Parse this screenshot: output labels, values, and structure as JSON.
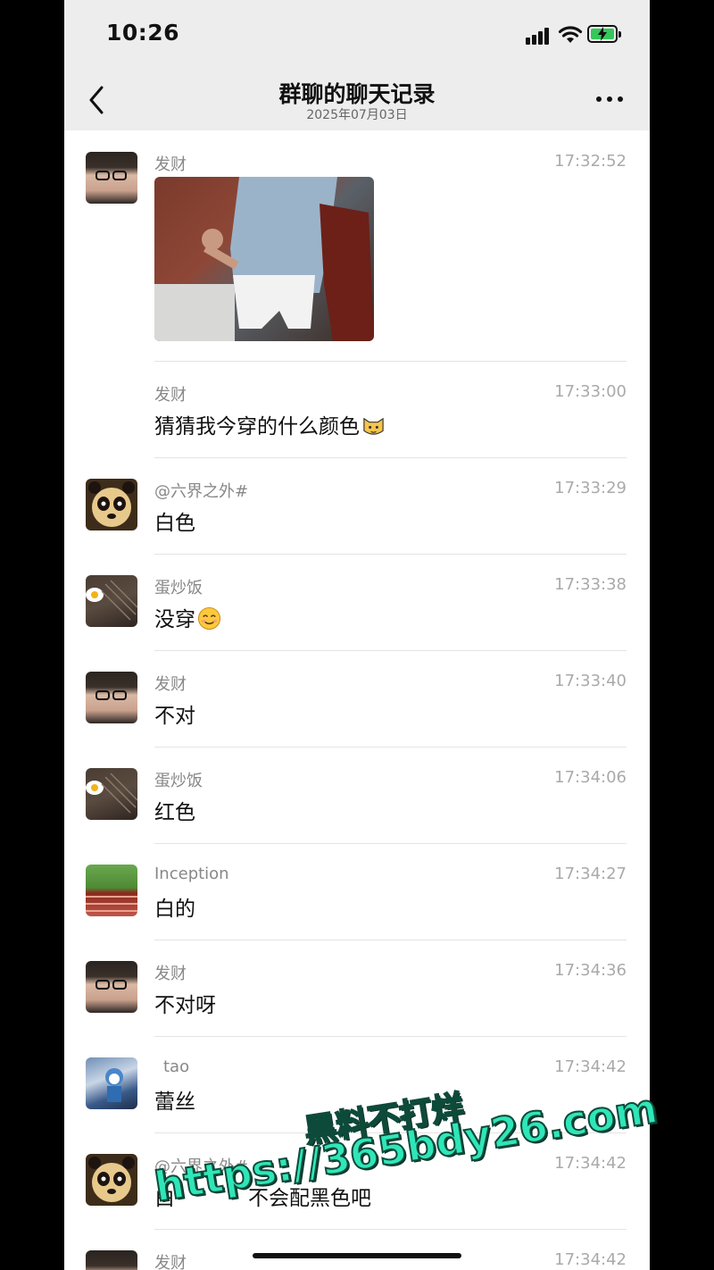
{
  "status_bar": {
    "time": "10:26"
  },
  "header": {
    "title": "群聊的聊天记录",
    "subtitle": "2025年07月03日"
  },
  "messages": [
    {
      "sender": "发财",
      "time": "17:32:52",
      "type": "image"
    },
    {
      "sender": "发财",
      "time": "17:33:00",
      "text": "猜猜我今穿的什么颜色",
      "emoji": "cat-emoji"
    },
    {
      "sender": "@六界之外#",
      "time": "17:33:29",
      "text": "白色"
    },
    {
      "sender": "蛋炒饭",
      "time": "17:33:38",
      "text": "没穿",
      "emoji": "smile-emoji"
    },
    {
      "sender": "发财",
      "time": "17:33:40",
      "text": "不对"
    },
    {
      "sender": "蛋炒饭",
      "time": "17:34:06",
      "text": "红色"
    },
    {
      "sender": "Inception",
      "time": "17:34:27",
      "text": "白的"
    },
    {
      "sender": "发财",
      "time": "17:34:36",
      "text": "不对呀"
    },
    {
      "sender": "tao",
      "time": "17:34:42",
      "text": "蕾丝"
    },
    {
      "sender": "@六界之外#",
      "time": "17:34:42",
      "text": "白",
      "text_tail": "不会配黑色吧"
    },
    {
      "sender": "发财",
      "time": "17:34:42"
    }
  ],
  "watermark": {
    "line1": "黑料不打烊",
    "line2": "https://365bdy26.com"
  }
}
